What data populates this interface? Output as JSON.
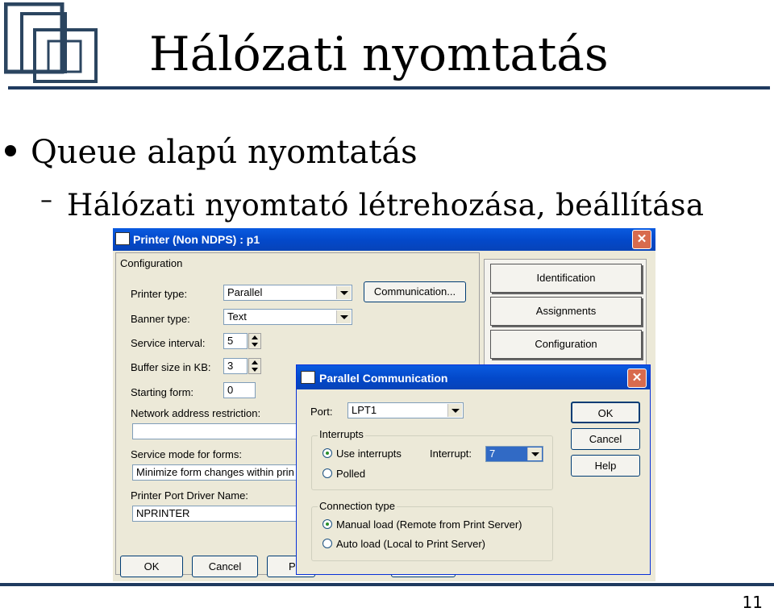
{
  "slide": {
    "title": "Hálózati nyomtatás",
    "bullet1": "Queue alapú nyomtatás",
    "dash": "–",
    "bullet2": "Hálózati nyomtató létrehozása, beállítása",
    "page_number": "11",
    "accent_color": "#1f3a5f"
  },
  "printer_window": {
    "title": "Printer (Non NDPS) : p1",
    "close": "✕",
    "section": "Configuration",
    "printer_type_label": "Printer type:",
    "printer_type_value": "Parallel",
    "banner_type_label": "Banner type:",
    "banner_type_value": "Text",
    "service_interval_label": "Service interval:",
    "service_interval_value": "5",
    "buffer_size_label": "Buffer size in KB:",
    "buffer_size_value": "3",
    "starting_form_label": "Starting form:",
    "starting_form_value": "0",
    "network_restriction_label": "Network address restriction:",
    "service_mode_label": "Service mode for forms:",
    "service_mode_value": "Minimize form changes within prin",
    "port_driver_label": "Printer Port Driver Name:",
    "port_driver_value": "NPRINTER",
    "communication_button": "Communication...",
    "tabs": [
      "Identification",
      "Assignments",
      "Configuration"
    ],
    "ok_button": "OK",
    "cancel_button": "Cancel",
    "p_button": "P"
  },
  "parallel_dialog": {
    "title": "Parallel Communication",
    "close": "✕",
    "port_label": "Port:",
    "port_value": "LPT1",
    "interrupts_group": "Interrupts",
    "use_interrupts": "Use interrupts",
    "interrupt_label": "Interrupt:",
    "interrupt_value": "7",
    "polled": "Polled",
    "connection_group": "Connection type",
    "manual_load": "Manual load (Remote from Print Server)",
    "auto_load": "Auto load (Local to Print Server)",
    "ok_button": "OK",
    "cancel_button": "Cancel",
    "help_button": "Help"
  }
}
